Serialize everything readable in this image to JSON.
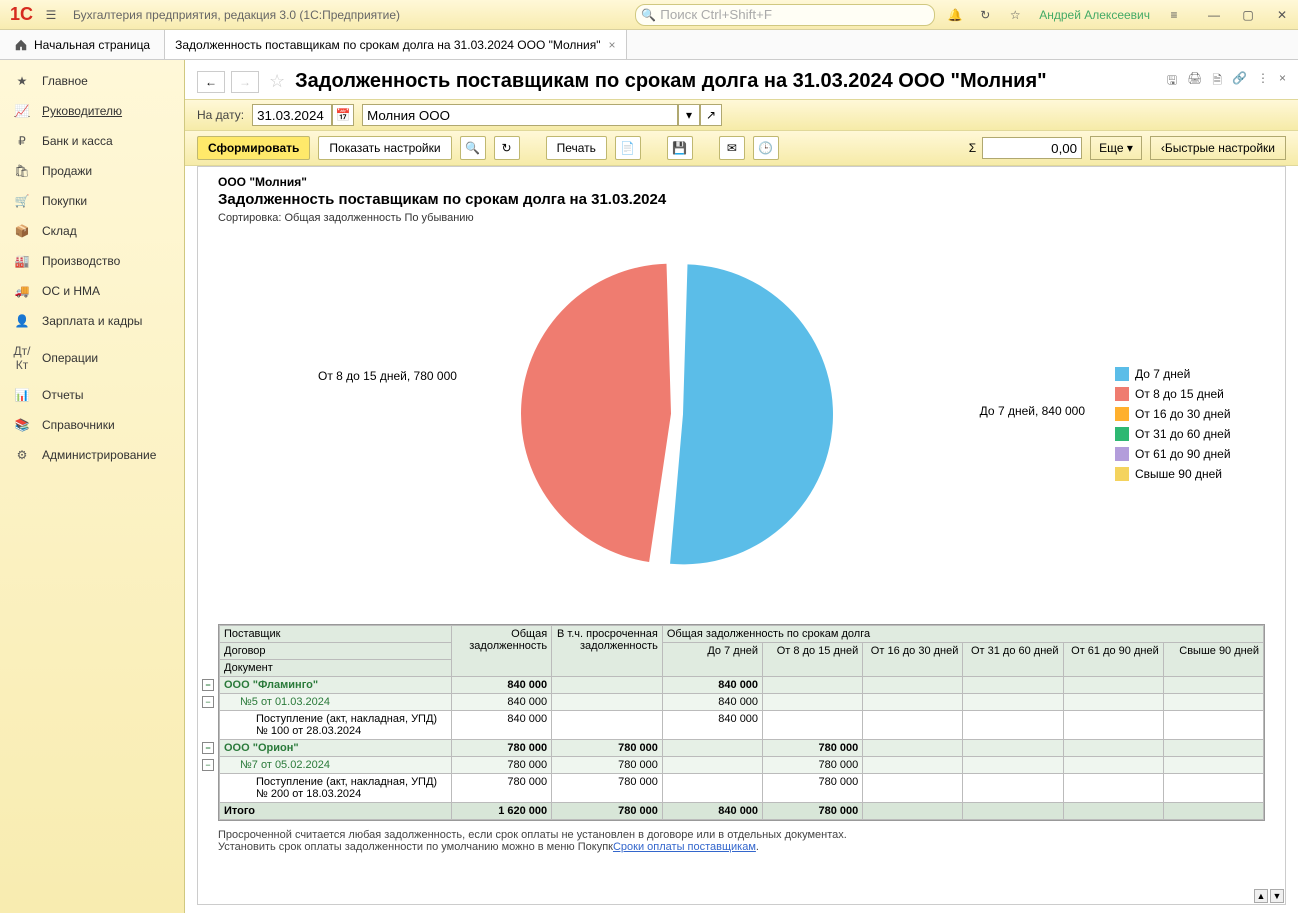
{
  "app": {
    "logo_text": "1C",
    "title": "Бухгалтерия предприятия, редакция 3.0  (1С:Предприятие)",
    "search_placeholder": "Поиск Ctrl+Shift+F",
    "username": "Андрей Алексеевич"
  },
  "tabs": {
    "home": "Начальная страница",
    "open": [
      {
        "label": "Задолженность поставщикам по срокам долга на 31.03.2024 ООО \"Молния\""
      }
    ]
  },
  "sidebar": {
    "items": [
      {
        "icon": "star",
        "label": "Главное"
      },
      {
        "icon": "trend",
        "label": "Руководителю",
        "active": true
      },
      {
        "icon": "ruble",
        "label": "Банк и касса"
      },
      {
        "icon": "bag",
        "label": "Продажи"
      },
      {
        "icon": "cart",
        "label": "Покупки"
      },
      {
        "icon": "box",
        "label": "Склад"
      },
      {
        "icon": "factory",
        "label": "Производство"
      },
      {
        "icon": "truck",
        "label": "ОС и НМА"
      },
      {
        "icon": "person",
        "label": "Зарплата и кадры"
      },
      {
        "icon": "dtkt",
        "label": "Операции"
      },
      {
        "icon": "bars",
        "label": "Отчеты"
      },
      {
        "icon": "book",
        "label": "Справочники"
      },
      {
        "icon": "gear",
        "label": "Администрирование"
      }
    ]
  },
  "report": {
    "title": "Задолженность поставщикам по срокам долга на 31.03.2024 ООО \"Молния\"",
    "params": {
      "date_label": "На дату:",
      "date_value": "31.03.2024",
      "org_value": "Молния ООО"
    },
    "toolbar": {
      "generate": "Сформировать",
      "show_settings": "Показать настройки",
      "print": "Печать",
      "sum_value": "0,00",
      "more": "Еще",
      "quick": "Быстрые настройки"
    },
    "body": {
      "org_title": "ООО \"Молния\"",
      "report_title": "Задолженность поставщикам по срокам долга на 31.03.2024",
      "sort_info": "Сортировка: Общая задолженность По убыванию",
      "chart_labels": {
        "slice1": "До 7 дней, 840 000",
        "slice2": "От 8 до 15 дней, 780 000"
      }
    },
    "legend": [
      {
        "color": "#5bbde8",
        "label": "До 7 дней"
      },
      {
        "color": "#ef7c70",
        "label": "От 8 до 15 дней"
      },
      {
        "color": "#ffb02e",
        "label": "От 16 до 30 дней"
      },
      {
        "color": "#2eb872",
        "label": "От 31 до 60 дней"
      },
      {
        "color": "#b39ddb",
        "label": "От 61 до 90 дней"
      },
      {
        "color": "#f4d35e",
        "label": "Свыше 90 дней"
      }
    ],
    "table": {
      "headers": {
        "c1a": "Поставщик",
        "c1b": "Договор",
        "c1c": "Документ",
        "c2": "Общая задолженность",
        "c3": "В т.ч. просроченная задолженность",
        "grp": "Общая задолженность по срокам долга",
        "b1": "До 7 дней",
        "b2": "От 8 до 15 дней",
        "b3": "От 16 до 30 дней",
        "b4": "От 31 до 60 дней",
        "b5": "От 61 до 90 дней",
        "b6": "Свыше 90 дней"
      },
      "rows": [
        {
          "level": 0,
          "name": "ООО \"Фламинго\"",
          "total": "840 000",
          "overdue": "",
          "b1": "840 000",
          "b2": "",
          "b3": "",
          "b4": "",
          "b5": "",
          "b6": ""
        },
        {
          "level": 1,
          "name": "№5 от 01.03.2024",
          "total": "840 000",
          "overdue": "",
          "b1": "840 000",
          "b2": "",
          "b3": "",
          "b4": "",
          "b5": "",
          "b6": ""
        },
        {
          "level": 2,
          "name": "Поступление (акт, накладная, УПД) № 100 от 28.03.2024",
          "total": "840 000",
          "overdue": "",
          "b1": "840 000",
          "b2": "",
          "b3": "",
          "b4": "",
          "b5": "",
          "b6": ""
        },
        {
          "level": 0,
          "name": "ООО \"Орион\"",
          "total": "780 000",
          "overdue": "780 000",
          "b1": "",
          "b2": "780 000",
          "b3": "",
          "b4": "",
          "b5": "",
          "b6": ""
        },
        {
          "level": 1,
          "name": "№7 от 05.02.2024",
          "total": "780 000",
          "overdue": "780 000",
          "b1": "",
          "b2": "780 000",
          "b3": "",
          "b4": "",
          "b5": "",
          "b6": ""
        },
        {
          "level": 2,
          "name": "Поступление (акт, накладная, УПД) № 200 от 18.03.2024",
          "total": "780 000",
          "overdue": "780 000",
          "b1": "",
          "b2": "780 000",
          "b3": "",
          "b4": "",
          "b5": "",
          "b6": ""
        }
      ],
      "total_row": {
        "name": "Итого",
        "total": "1 620 000",
        "overdue": "780 000",
        "b1": "840 000",
        "b2": "780 000",
        "b3": "",
        "b4": "",
        "b5": "",
        "b6": ""
      }
    },
    "footnote": {
      "line1": "Просроченной считается любая задолженность, если срок оплаты не установлен в договоре или в отдельных документах.",
      "line2_pre": "Установить срок оплаты задолженности по умолчанию можно в меню Покупк",
      "link": "Сроки оплаты поставщикам",
      "line2_post": "."
    }
  },
  "chart_data": {
    "type": "pie",
    "title": "Задолженность поставщикам по срокам долга на 31.03.2024",
    "categories": [
      "До 7 дней",
      "От 8 до 15 дней",
      "От 16 до 30 дней",
      "От 31 до 60 дней",
      "От 61 до 90 дней",
      "Свыше 90 дней"
    ],
    "values": [
      840000,
      780000,
      0,
      0,
      0,
      0
    ],
    "colors": [
      "#5bbde8",
      "#ef7c70",
      "#ffb02e",
      "#2eb872",
      "#b39ddb",
      "#f4d35e"
    ],
    "total": 1620000
  }
}
